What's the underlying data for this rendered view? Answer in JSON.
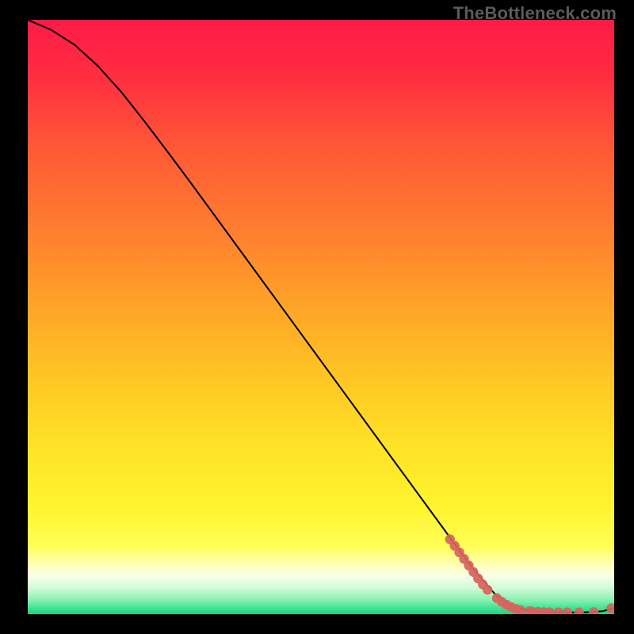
{
  "watermark": "TheBottleneck.com",
  "chart_data": {
    "type": "line",
    "title": "",
    "xlabel": "",
    "ylabel": "",
    "xlim": [
      0,
      100
    ],
    "ylim": [
      0,
      100
    ],
    "grid": false,
    "legend": false,
    "series": [
      {
        "name": "curve",
        "style": "line",
        "x": [
          0,
          4,
          8,
          12,
          16,
          20,
          24,
          28,
          32,
          36,
          40,
          44,
          48,
          52,
          56,
          60,
          64,
          68,
          72,
          76,
          80,
          83,
          86,
          88,
          90,
          92,
          94,
          96,
          98,
          100
        ],
        "y": [
          100,
          98.3,
          95.8,
          92.2,
          87.8,
          82.8,
          77.6,
          72.3,
          66.9,
          61.5,
          56.1,
          50.7,
          45.3,
          39.9,
          34.5,
          29.1,
          23.7,
          18.3,
          12.9,
          7.6,
          3.0,
          1.2,
          0.5,
          0.35,
          0.3,
          0.3,
          0.3,
          0.35,
          0.5,
          1.0
        ]
      },
      {
        "name": "markers",
        "style": "points",
        "x": [
          72,
          72.8,
          73.6,
          74.4,
          75.2,
          76,
          76.8,
          77.6,
          78.4,
          80,
          80.8,
          81.6,
          82.4,
          83.2,
          84,
          85.5,
          86,
          87,
          88,
          89,
          90.5,
          92,
          94,
          96.5,
          99.5
        ],
        "y": [
          12.6,
          11.5,
          10.4,
          9.3,
          8.2,
          7.1,
          6.0,
          5.0,
          4.1,
          2.7,
          2.1,
          1.6,
          1.2,
          0.9,
          0.7,
          0.5,
          0.45,
          0.4,
          0.35,
          0.32,
          0.3,
          0.3,
          0.3,
          0.35,
          1.0
        ]
      }
    ],
    "background_gradient": {
      "stops": [
        {
          "offset": 0.0,
          "color": "#ff1a46"
        },
        {
          "offset": 0.1,
          "color": "#ff2f3f"
        },
        {
          "offset": 0.22,
          "color": "#ff5a36"
        },
        {
          "offset": 0.35,
          "color": "#ff7d2f"
        },
        {
          "offset": 0.48,
          "color": "#ffa328"
        },
        {
          "offset": 0.6,
          "color": "#ffc524"
        },
        {
          "offset": 0.72,
          "color": "#ffe326"
        },
        {
          "offset": 0.82,
          "color": "#fff42f"
        },
        {
          "offset": 0.885,
          "color": "#ffff55"
        },
        {
          "offset": 0.915,
          "color": "#ffffb5"
        },
        {
          "offset": 0.935,
          "color": "#f8ffe6"
        },
        {
          "offset": 0.955,
          "color": "#d2fcd8"
        },
        {
          "offset": 0.975,
          "color": "#8ef2b3"
        },
        {
          "offset": 0.99,
          "color": "#3fe392"
        },
        {
          "offset": 1.0,
          "color": "#18d47d"
        }
      ]
    },
    "marker_color": "#d8635e",
    "line_color": "#000000"
  }
}
